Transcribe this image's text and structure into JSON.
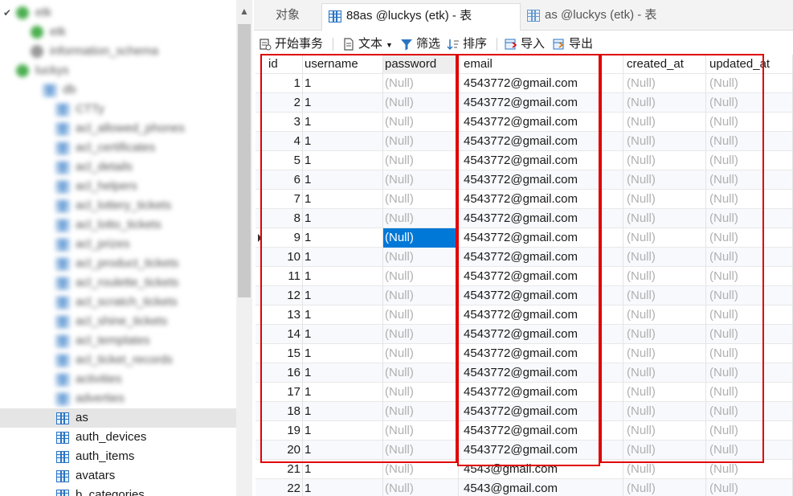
{
  "tabs": [
    {
      "label": "对象",
      "active": false
    },
    {
      "label": "88as @luckys (etk) - 表",
      "active": true
    },
    {
      "label": "as @luckys (etk) - 表",
      "active": false
    }
  ],
  "toolbar": {
    "begin_transaction": "开始事务",
    "text": "文本",
    "filter": "筛选",
    "sort": "排序",
    "import": "导入",
    "export": "导出"
  },
  "sidebar": {
    "blurred_rows": [
      "etk",
      "etk",
      "information_schema",
      "luckys",
      "db",
      "CTTy",
      "acl_allowed_phones",
      "acl_certificates",
      "acl_details",
      "acl_helpers",
      "acl_lottery_tickets",
      "acl_lotto_tickets",
      "acl_prizes",
      "acl_product_tickets",
      "acl_roulette_tickets",
      "acl_scratch_tickets",
      "acl_shine_tickets",
      "acl_templates",
      "acl_ticket_records",
      "activities",
      "adverties"
    ],
    "items": [
      "as",
      "auth_devices",
      "auth_items",
      "avatars",
      "b_categories"
    ],
    "selected": "as"
  },
  "grid": {
    "columns": [
      "id",
      "username",
      "password",
      "email",
      "created_at",
      "updated_at"
    ],
    "null_text": "(Null)",
    "rows": [
      {
        "id": "1",
        "username": "1",
        "email": "4543772@gmail.com"
      },
      {
        "id": "2",
        "username": "1",
        "email": "4543772@gmail.com"
      },
      {
        "id": "3",
        "username": "1",
        "email": "4543772@gmail.com"
      },
      {
        "id": "4",
        "username": "1",
        "email": "4543772@gmail.com"
      },
      {
        "id": "5",
        "username": "1",
        "email": "4543772@gmail.com"
      },
      {
        "id": "6",
        "username": "1",
        "email": "4543772@gmail.com"
      },
      {
        "id": "7",
        "username": "1",
        "email": "4543772@gmail.com"
      },
      {
        "id": "8",
        "username": "1",
        "email": "4543772@gmail.com"
      },
      {
        "id": "9",
        "username": "1",
        "email": "4543772@gmail.com",
        "selected": true
      },
      {
        "id": "10",
        "username": "1",
        "email": "4543772@gmail.com"
      },
      {
        "id": "11",
        "username": "1",
        "email": "4543772@gmail.com"
      },
      {
        "id": "12",
        "username": "1",
        "email": "4543772@gmail.com"
      },
      {
        "id": "13",
        "username": "1",
        "email": "4543772@gmail.com"
      },
      {
        "id": "14",
        "username": "1",
        "email": "4543772@gmail.com"
      },
      {
        "id": "15",
        "username": "1",
        "email": "4543772@gmail.com"
      },
      {
        "id": "16",
        "username": "1",
        "email": "4543772@gmail.com"
      },
      {
        "id": "17",
        "username": "1",
        "email": "4543772@gmail.com"
      },
      {
        "id": "18",
        "username": "1",
        "email": "4543772@gmail.com"
      },
      {
        "id": "19",
        "username": "1",
        "email": "4543772@gmail.com"
      },
      {
        "id": "20",
        "username": "1",
        "email": "4543772@gmail.com"
      },
      {
        "id": "21",
        "username": "1",
        "email": "4543@gmail.com"
      },
      {
        "id": "22",
        "username": "1",
        "email": "4543@gmail.com"
      }
    ]
  },
  "colors": {
    "annotation_red": "#e00000",
    "selection_blue": "#0078d7",
    "table_icon_blue": "#2a74c2",
    "null_gray": "#b0b0b0"
  }
}
